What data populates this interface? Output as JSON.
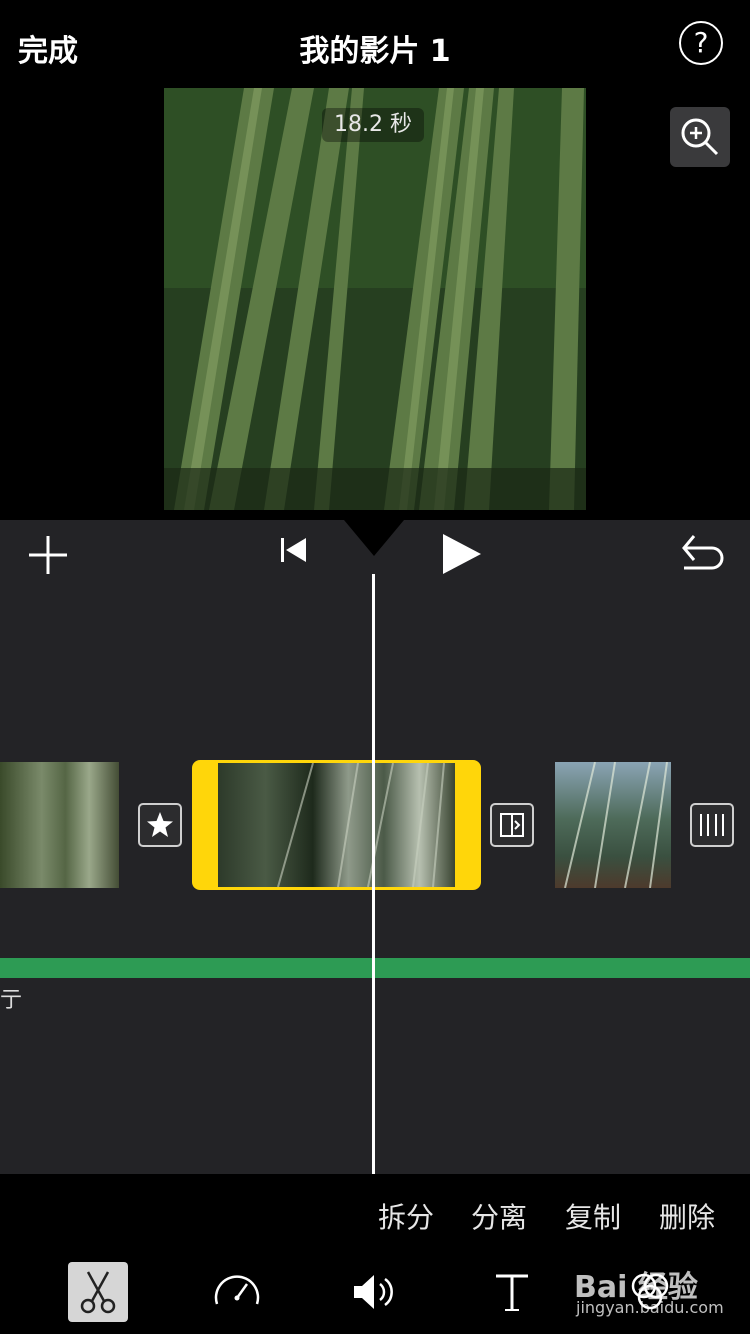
{
  "header": {
    "done_label": "完成",
    "title": "我的影片 1",
    "help_label": "?"
  },
  "preview": {
    "duration": "18.2 秒"
  },
  "timeline": {
    "audio_label": "亍"
  },
  "actions": {
    "split": "拆分",
    "detach": "分离",
    "duplicate": "复制",
    "delete": "删除"
  },
  "watermark": {
    "brand": "Bai 经验",
    "url": "jingyan.baidu.com"
  },
  "colors": {
    "selection": "#ffd60a",
    "audio_track": "#2d9b54",
    "timeline_bg": "#232326"
  }
}
